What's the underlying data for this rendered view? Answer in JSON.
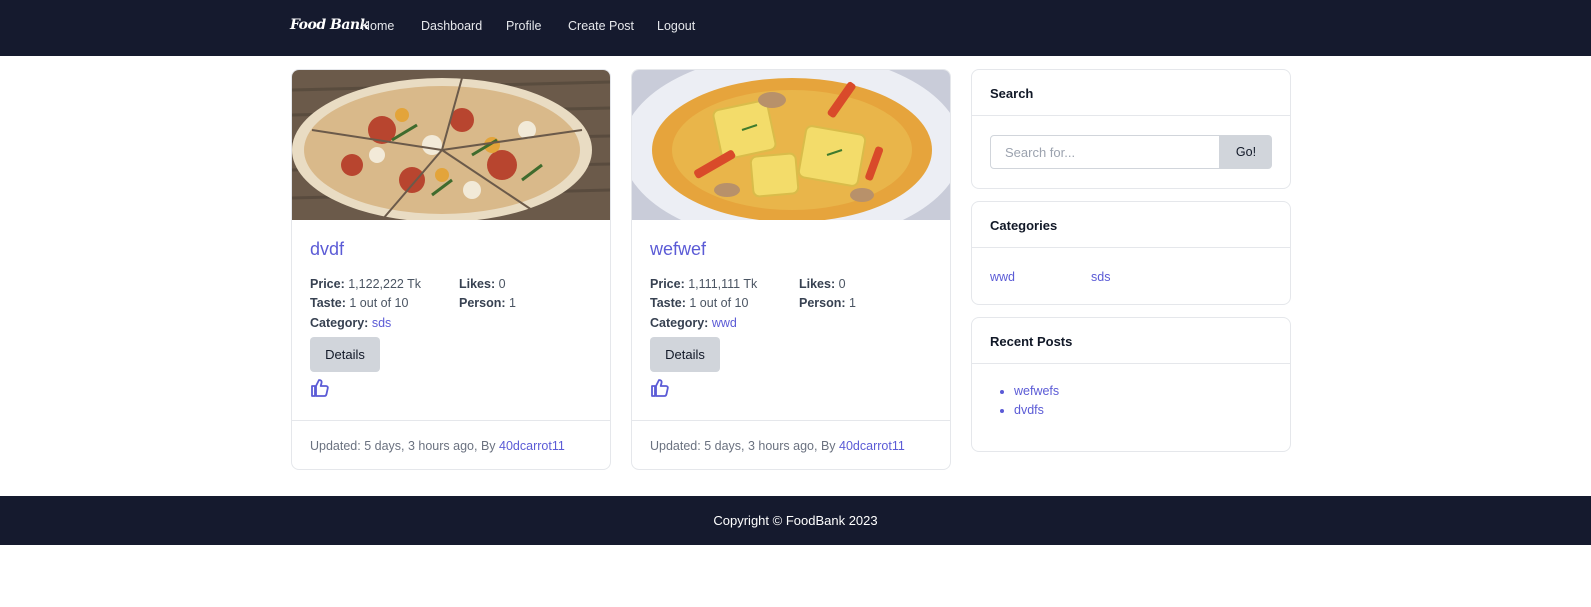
{
  "nav": {
    "brand": "Food Bank",
    "links": [
      "Home",
      "Dashboard",
      "Profile",
      "Create Post",
      "Logout"
    ]
  },
  "posts": [
    {
      "title": "dvdf",
      "price_label": "Price:",
      "price": "1,122,222 Tk",
      "likes_label": "Likes:",
      "likes": "0",
      "taste_label": "Taste:",
      "taste": "1 out of 10",
      "person_label": "Person:",
      "person": "1",
      "category_label": "Category:",
      "category": "sds",
      "details_label": "Details",
      "updated": "Updated: 5 days, 3 hours ago, By ",
      "author": "40dcarrot11",
      "image_alt": "pizza"
    },
    {
      "title": "wefwef",
      "price_label": "Price:",
      "price": "1,111,111 Tk",
      "likes_label": "Likes:",
      "likes": "0",
      "taste_label": "Taste:",
      "taste": "1 out of 10",
      "person_label": "Person:",
      "person": "1",
      "category_label": "Category:",
      "category": "wwd",
      "details_label": "Details",
      "updated": "Updated: 5 days, 3 hours ago, By ",
      "author": "40dcarrot11",
      "image_alt": "ravioli"
    }
  ],
  "sidebar": {
    "search": {
      "title": "Search",
      "placeholder": "Search for...",
      "button": "Go!"
    },
    "categories": {
      "title": "Categories",
      "items": [
        "wwd",
        "sds"
      ]
    },
    "recent": {
      "title": "Recent Posts",
      "items": [
        "wefwefs",
        "dvdfs"
      ]
    }
  },
  "footer": {
    "text": "Copyright © FoodBank 2023"
  },
  "colors": {
    "nav_bg": "#151a2e",
    "accent": "#5b5bd6",
    "button_bg": "#d1d5db"
  }
}
